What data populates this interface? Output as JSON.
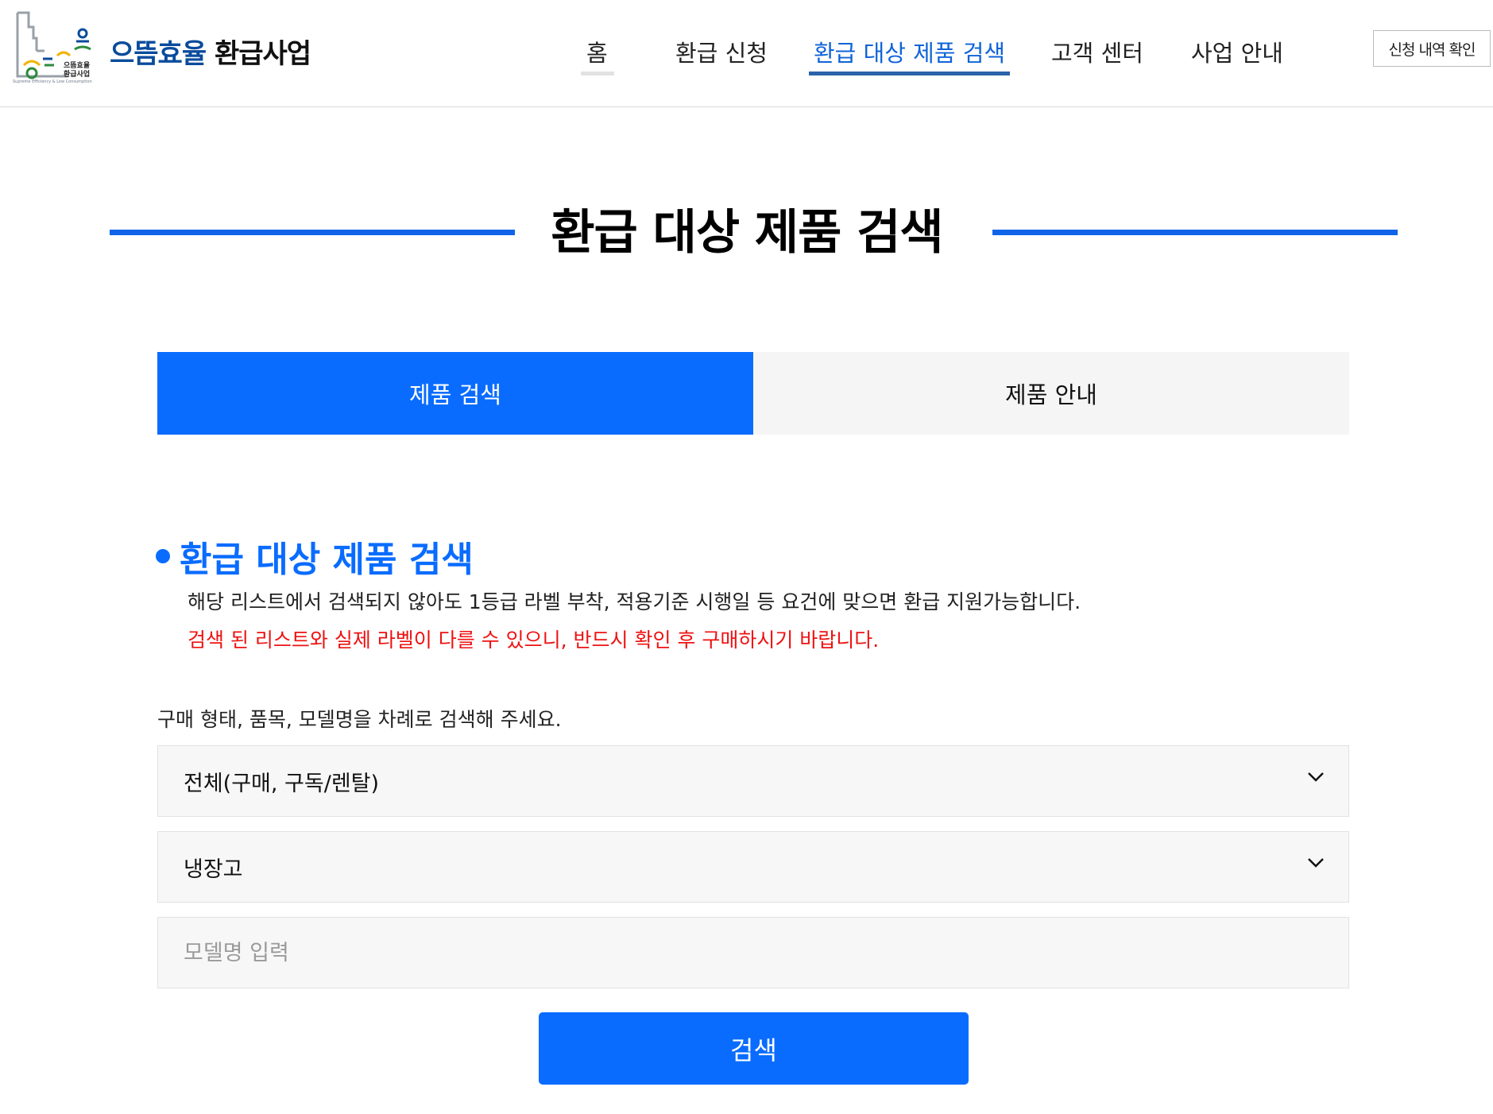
{
  "header": {
    "logo_mark_text": [
      "으뜸효율",
      "환급사업"
    ],
    "logo_subtext": "Supreme Efficiency & Low Consumption",
    "brand_part1": "으뜸효율",
    "brand_part2": "환급사업",
    "nav": [
      {
        "label": "홈",
        "state": "hover"
      },
      {
        "label": "환급 신청",
        "state": "normal"
      },
      {
        "label": "환급 대상 제품 검색",
        "state": "active"
      },
      {
        "label": "고객 센터",
        "state": "normal"
      },
      {
        "label": "사업 안내",
        "state": "normal"
      }
    ],
    "history_button": "신청 내역 확인"
  },
  "page_title": "환급 대상 제품 검색",
  "tabs": [
    {
      "label": "제품 검색",
      "active": true
    },
    {
      "label": "제품 안내",
      "active": false
    }
  ],
  "section": {
    "title": "환급 대상 제품 검색",
    "desc": "해당 리스트에서 검색되지 않아도 1등급 라벨 부착, 적용기준 시행일 등 요건에 맞으면 환급 지원가능합니다.",
    "warning": "검색 된 리스트와 실제 라벨이 다를 수 있으니, 반드시 확인 후 구매하시기 바랍니다."
  },
  "form": {
    "guide": "구매 형태, 품목, 모델명을 차례로 검색해 주세요.",
    "purchase_type": "전체(구매, 구독/렌탈)",
    "category": "냉장고",
    "model_value": "",
    "model_placeholder": "모델명 입력",
    "search_button": "검색"
  },
  "colors": {
    "primary": "#0a6cff",
    "nav_active": "#1064d8",
    "nav_active_bar": "#2a63a8",
    "nav_hover_bar": "#e2e2e2",
    "title_line": "#1064e8",
    "warning": "#ee1111",
    "brand_blue": "#0a4b9c",
    "tab_inactive_bg": "#f5f5f5",
    "field_bg": "#f7f7f7"
  },
  "icons": [
    "chevron-down-icon",
    "chevron-down-icon"
  ]
}
